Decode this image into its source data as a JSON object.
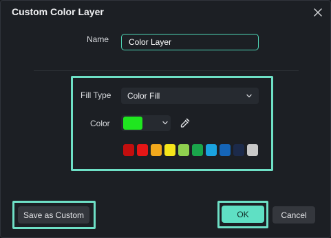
{
  "dialog": {
    "title": "Custom Color Layer",
    "close_icon": "close-icon"
  },
  "name": {
    "label": "Name",
    "value": "Color Layer"
  },
  "fill_type": {
    "label": "Fill Type",
    "value": "Color Fill",
    "icon": "chevron-down-icon"
  },
  "color": {
    "label": "Color",
    "current": "#1fe61f",
    "eyedropper_icon": "eyedropper-icon"
  },
  "palette": [
    {
      "name": "dark-red",
      "color": "#c20e0e"
    },
    {
      "name": "red",
      "color": "#e51616"
    },
    {
      "name": "orange",
      "color": "#f2a81c"
    },
    {
      "name": "yellow",
      "color": "#f5e51a"
    },
    {
      "name": "light-green",
      "color": "#8fd14f"
    },
    {
      "name": "green",
      "color": "#1aa64b"
    },
    {
      "name": "light-blue",
      "color": "#1aa3e0"
    },
    {
      "name": "blue",
      "color": "#1565b8"
    },
    {
      "name": "navy",
      "color": "#1c2a4a"
    },
    {
      "name": "light-gray",
      "color": "#c8c8c8"
    }
  ],
  "footer": {
    "save_custom_label": "Save as Custom",
    "ok_label": "OK",
    "cancel_label": "Cancel"
  },
  "colors": {
    "accent": "#5fe0c4",
    "highlight_border": "#6ee0c6",
    "background": "#1c1f24"
  }
}
